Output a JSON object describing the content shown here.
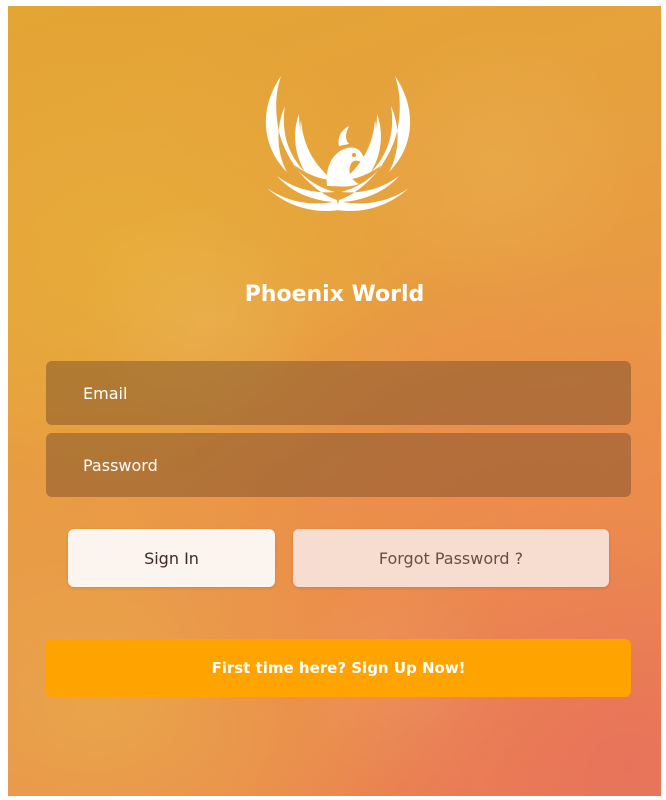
{
  "app": {
    "title": "Phoenix World"
  },
  "form": {
    "email_placeholder": "Email",
    "password_placeholder": "Password"
  },
  "actions": {
    "sign_in_label": "Sign In",
    "forgot_label": "Forgot Password ?",
    "signup_label": "First time here? Sign Up Now!"
  },
  "icons": {
    "logo": "phoenix-logo-icon"
  },
  "colors": {
    "background_top": "#e3a533",
    "background_bottom": "#ea7c55",
    "field_fill": "#6e4828",
    "sign_in_button": "#fbf4ef",
    "forgot_button": "#f6ddd0",
    "signup_button": "#ffa300"
  }
}
